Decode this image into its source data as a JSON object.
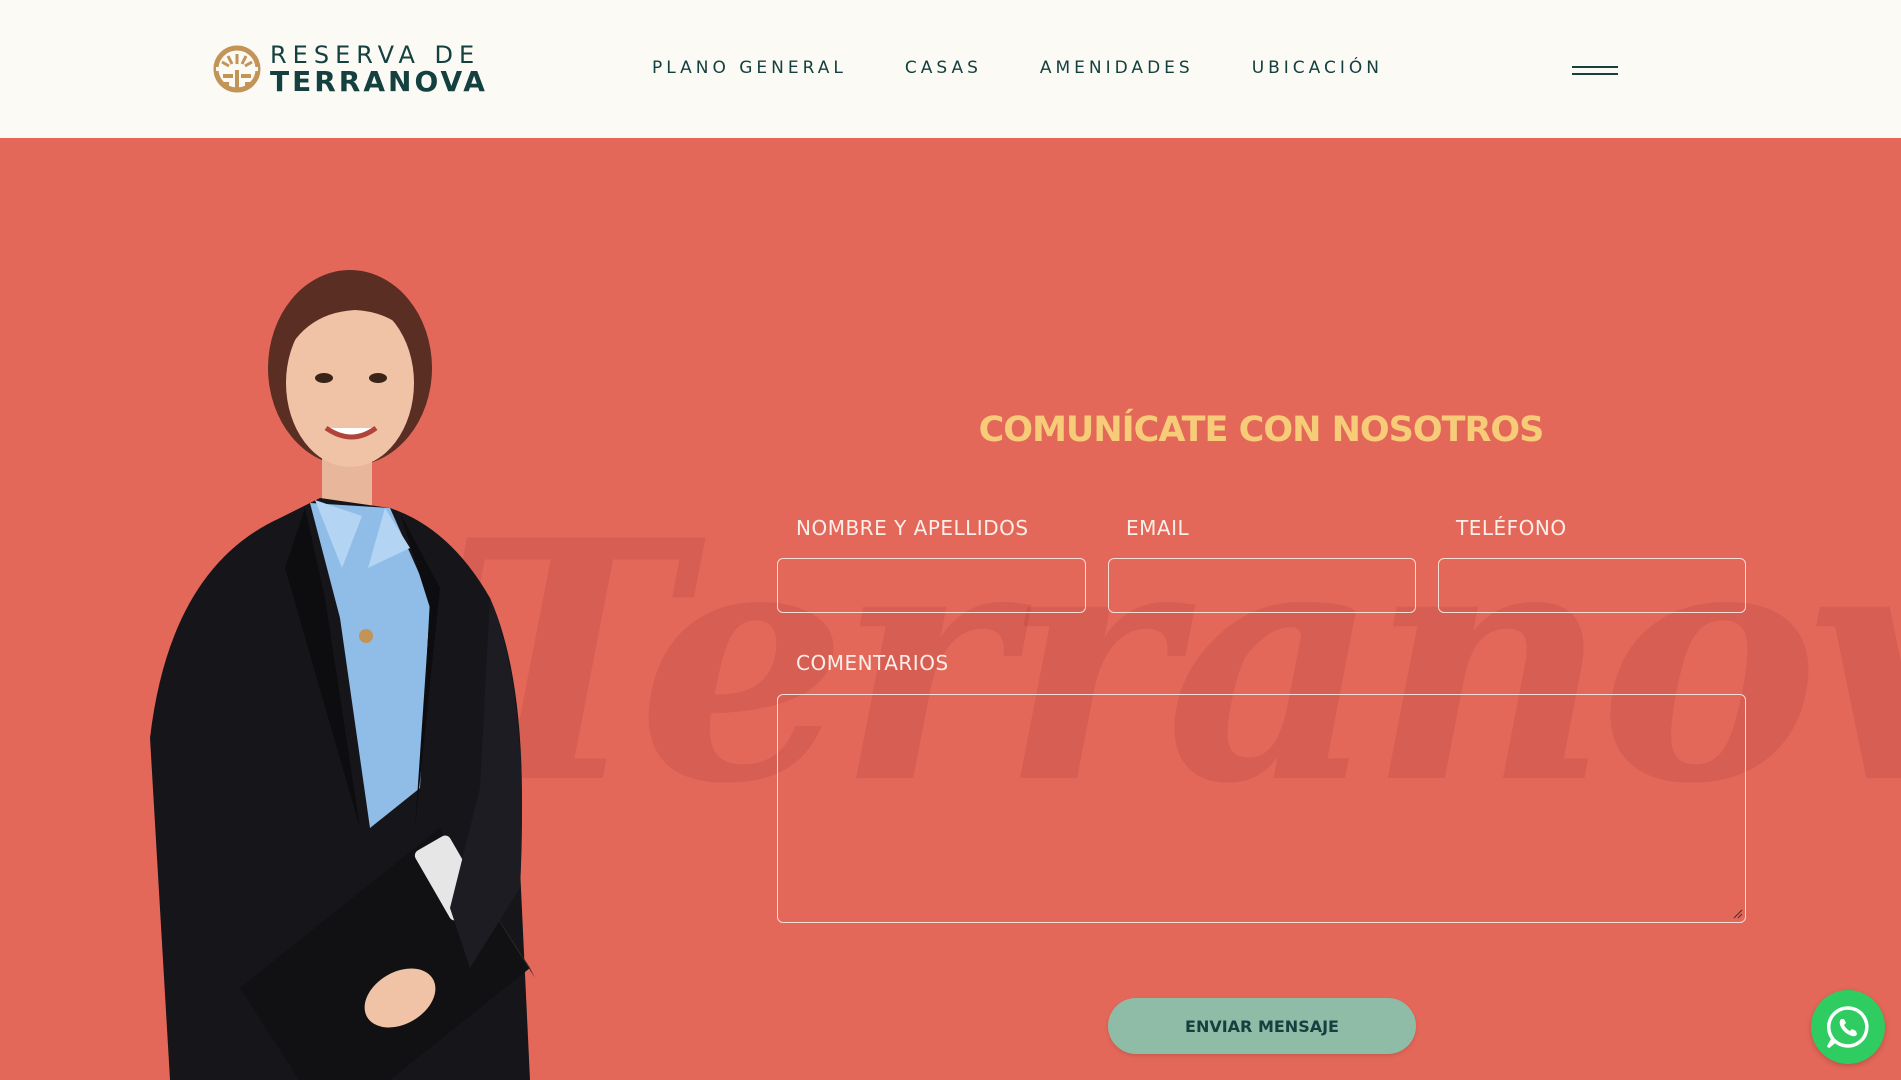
{
  "brand": {
    "line1": "RESERVA DE",
    "line2": "TERRANOVA",
    "logo_icon": "terranova-sun-logo-icon",
    "logo_color": "#c29457",
    "primary_color": "#14403f"
  },
  "nav": {
    "items": [
      {
        "label": "PLANO GENERAL"
      },
      {
        "label": "CASAS"
      },
      {
        "label": "AMENIDADES"
      },
      {
        "label": "UBICACIÓN"
      }
    ],
    "menu_icon": "hamburger-menu-icon"
  },
  "contact": {
    "background_color": "#e4685a",
    "title": "COMUNÍCATE CON NOSOTROS",
    "title_color": "#f7cc78",
    "watermark": "Terranova",
    "fields": {
      "name": {
        "label": "NOMBRE Y APELLIDOS",
        "value": ""
      },
      "email": {
        "label": "EMAIL",
        "value": ""
      },
      "phone": {
        "label": "TELÉFONO",
        "value": ""
      },
      "comments": {
        "label": "COMENTARIOS",
        "value": ""
      }
    },
    "submit_label": "ENVIAR MENSAJE",
    "submit_color": "#8fbca7"
  },
  "floating": {
    "whatsapp_icon": "whatsapp-icon",
    "whatsapp_color": "#2fcc61"
  }
}
